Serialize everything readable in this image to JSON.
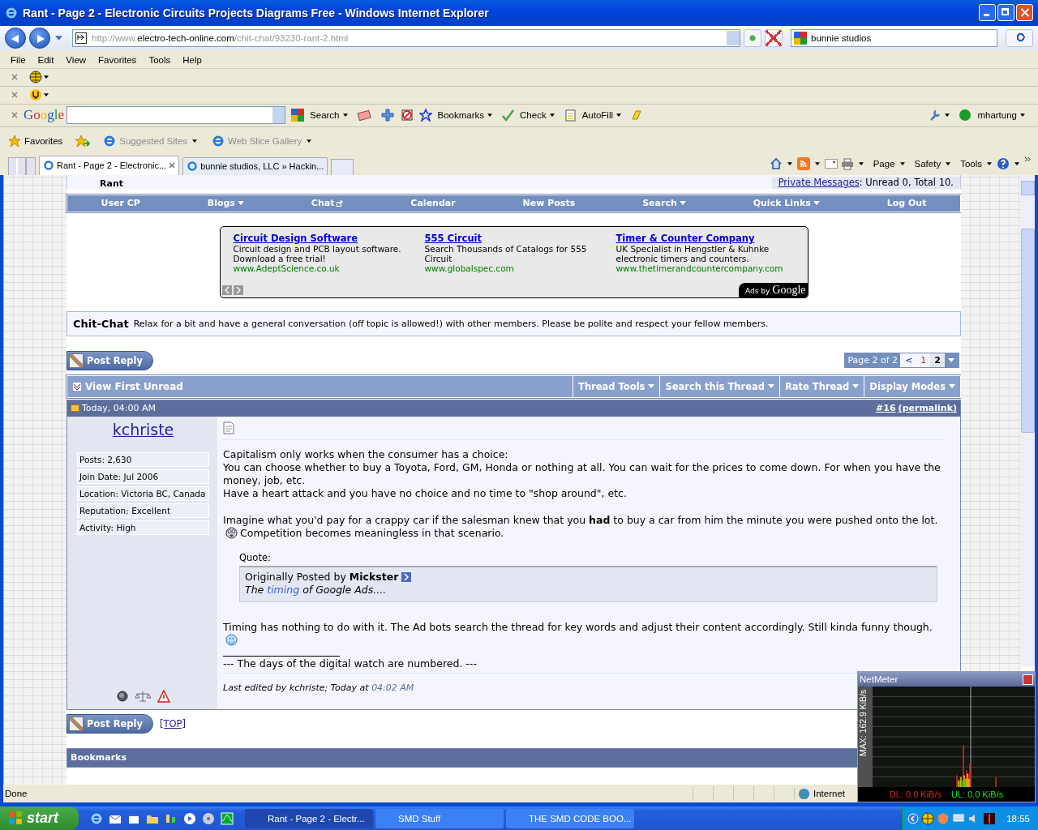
{
  "window": {
    "title": "Rant - Page 2 - Electronic Circuits Projects Diagrams Free - Windows Internet Explorer"
  },
  "address_bar": {
    "url_prefix": "http://www.",
    "url_domain": "electro-tech-online.com",
    "url_path": "/chit-chat/93230-rant-2.html"
  },
  "search_box": {
    "value": "bunnie studios"
  },
  "menu": [
    "File",
    "Edit",
    "View",
    "Favorites",
    "Tools",
    "Help"
  ],
  "google_toolbar": {
    "logo": "Google",
    "search": "Search",
    "bookmarks": "Bookmarks",
    "check": "Check",
    "autofill": "AutoFill",
    "user": "mhartung"
  },
  "favorites_bar": {
    "label": "Favorites",
    "links": [
      "Suggested Sites",
      "Web Slice Gallery"
    ]
  },
  "tabs": [
    {
      "label": "Rant - Page 2 - Electronic...",
      "selected": true
    },
    {
      "label": "bunnie studios, LLC » Hackin...",
      "selected": false
    }
  ],
  "command_bar": [
    "Page",
    "Safety",
    "Tools"
  ],
  "forum": {
    "header_title": "Rant",
    "private_messages_link": "Private Messages",
    "private_messages_text": ": Unread 0, Total 10.",
    "navbar": [
      {
        "label": "User CP",
        "kind": "link"
      },
      {
        "label": "Blogs",
        "kind": "menu"
      },
      {
        "label": "Chat",
        "kind": "external"
      },
      {
        "label": "Calendar",
        "kind": "link"
      },
      {
        "label": "New Posts",
        "kind": "link"
      },
      {
        "label": "Search",
        "kind": "menu"
      },
      {
        "label": "Quick Links",
        "kind": "menu"
      },
      {
        "label": "Log Out",
        "kind": "link"
      }
    ],
    "ads": [
      {
        "title": "Circuit Design Software",
        "text": "Circuit design and PCB layout software. Download a free trial!",
        "url": "www.AdeptScience.co.uk"
      },
      {
        "title": "555 Circuit",
        "text": "Search Thousands of Catalogs for 555 Circuit",
        "url": "www.globalspec.com"
      },
      {
        "title": "Timer & Counter Company",
        "text": "UK Specialist in Hengstler & Kuhnke electronic timers and counters.",
        "url": "www.thetimerandcountercompany.com"
      }
    ],
    "ads_by": "Ads by",
    "ads_brand": "Google",
    "description_name": "Chit-Chat",
    "description_text": "Relax for a bit and have a general conversation (off topic is allowed!) with other members. Please be polite and respect your fellow members.",
    "post_reply_buttons": [
      "Post Reply",
      "Post Reply"
    ],
    "pagination": {
      "label": "Page 2 of 2",
      "prev": "<",
      "pages": [
        {
          "label": "1",
          "selected": false
        },
        {
          "label": "2",
          "selected": true
        }
      ]
    },
    "view_first_unread": "View First Unread",
    "thread_tools": [
      "Thread Tools",
      "Search this Thread",
      "Rate Thread",
      "Display Modes"
    ],
    "post": {
      "date": "Today, 04:00 AM",
      "number": "#16",
      "permalink": "(permalink)",
      "username": "kchriste",
      "user_info": [
        "Posts: 2,630",
        "Join Date: Jul 2006",
        "Location: Victoria BC, Canada",
        "Reputation: Excellent",
        "Activity: High"
      ],
      "lines": [
        "Capitalism only works when the consumer has a choice:",
        "You can choose whether to buy a Toyota, Ford, GM, Honda or nothing at all. You can wait for the prices to come down. For when you have the money, job, etc.",
        "Have a heart attack and you have no choice and no time to \"shop around\", etc."
      ],
      "paragraph_2_before": "Imagine what you'd pay for a crappy car if the salesman knew that you **had** to buy a car from him the minute you were pushed onto the lot.",
      "paragraph_2_after": "Competition becomes meaningless in that scenario.",
      "quote": {
        "label": "Quote:",
        "posted_by": "Originally Posted by **Mickster**",
        "before": "The",
        "link": "timing",
        "after": "of Google Ads...."
      },
      "paragraph_3": "Timing has nothing to do with it. The Ad bots search the thread for key words and adjust their content accordingly. Still kinda funny though.",
      "signature": "--- The days of the digital watch are numbered. ---",
      "edited": "Last edited by kchriste; Today at",
      "edited_time": "04:02 AM"
    },
    "top_link": "[TOP]",
    "bookmarks_heading": "Bookmarks"
  },
  "status_bar": {
    "text": "Done",
    "zone": "Internet"
  },
  "taskbar": {
    "start": "start",
    "windows": [
      {
        "label": "Rant - Page 2 - Electr...",
        "selected": true
      },
      {
        "label": "SMD Stuff",
        "selected": false
      },
      {
        "label": "THE SMD CODE BOO...",
        "selected": false
      }
    ],
    "clock": "18:55"
  },
  "netmeter": {
    "title": "NetMeter",
    "max": "MAX: 162.9 KiB/s",
    "dl": "DL: 0.0 KiB/s",
    "ul": "UL: 0.0 KiB/s"
  }
}
